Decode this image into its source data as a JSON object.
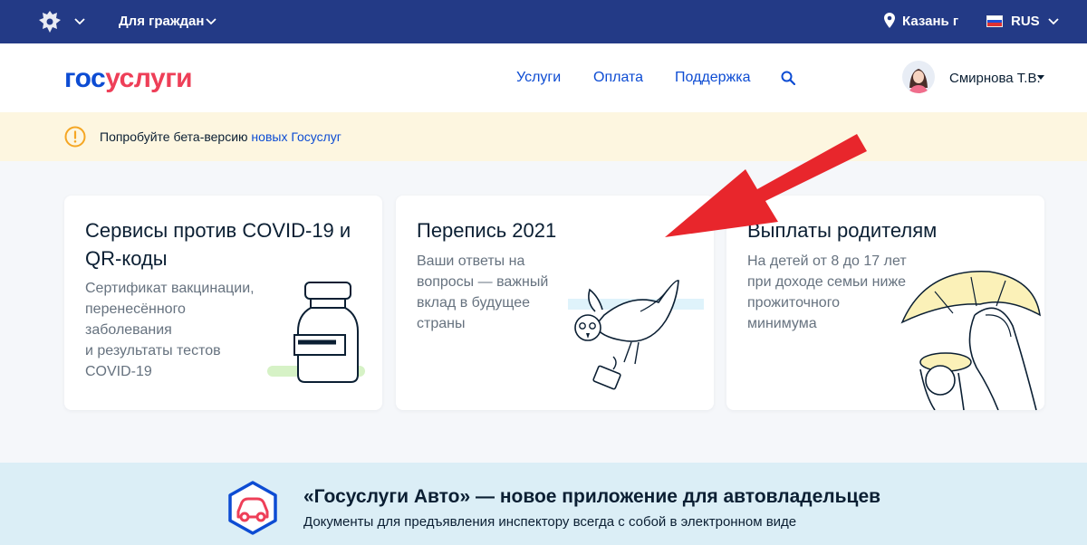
{
  "topbar": {
    "audience": "Для граждан",
    "location": "Казань г",
    "language": "RUS"
  },
  "header": {
    "logo_part1": "гос",
    "logo_part2": "услуги",
    "nav": [
      "Услуги",
      "Оплата",
      "Поддержка"
    ],
    "user_name": "Смирнова Т.В."
  },
  "beta_banner": {
    "text": "Попробуйте бета-версию ",
    "link": "новых Госуслуг"
  },
  "cards": [
    {
      "title": "Сервисы против COVID-19 и QR-коды",
      "desc": [
        "Сертификат вакцинации,",
        "перенесённого",
        "заболевания",
        "и результаты тестов",
        "COVID-19"
      ]
    },
    {
      "title": "Перепись 2021",
      "desc": [
        "Ваши ответы на",
        "вопросы — важный",
        "вклад в будущее",
        "страны"
      ]
    },
    {
      "title": "Выплаты родителям",
      "desc": [
        "На детей от 8 до 17 лет",
        "при доходе семьи ниже",
        "прожиточного",
        "минимума"
      ]
    }
  ],
  "auto_promo": {
    "title": "«Госуслуги Авто» — новое приложение для автовладельцев",
    "subtitle": "Документы для предъявления инспектору всегда с собой в электронном виде"
  },
  "colors": {
    "topbar": "#233a86",
    "brand_blue": "#0d4cd3",
    "brand_red": "#ee3f58",
    "banner_bg": "#fdf6e0",
    "promo_bg": "#dbeef6",
    "annotation_arrow": "#e8262c"
  }
}
